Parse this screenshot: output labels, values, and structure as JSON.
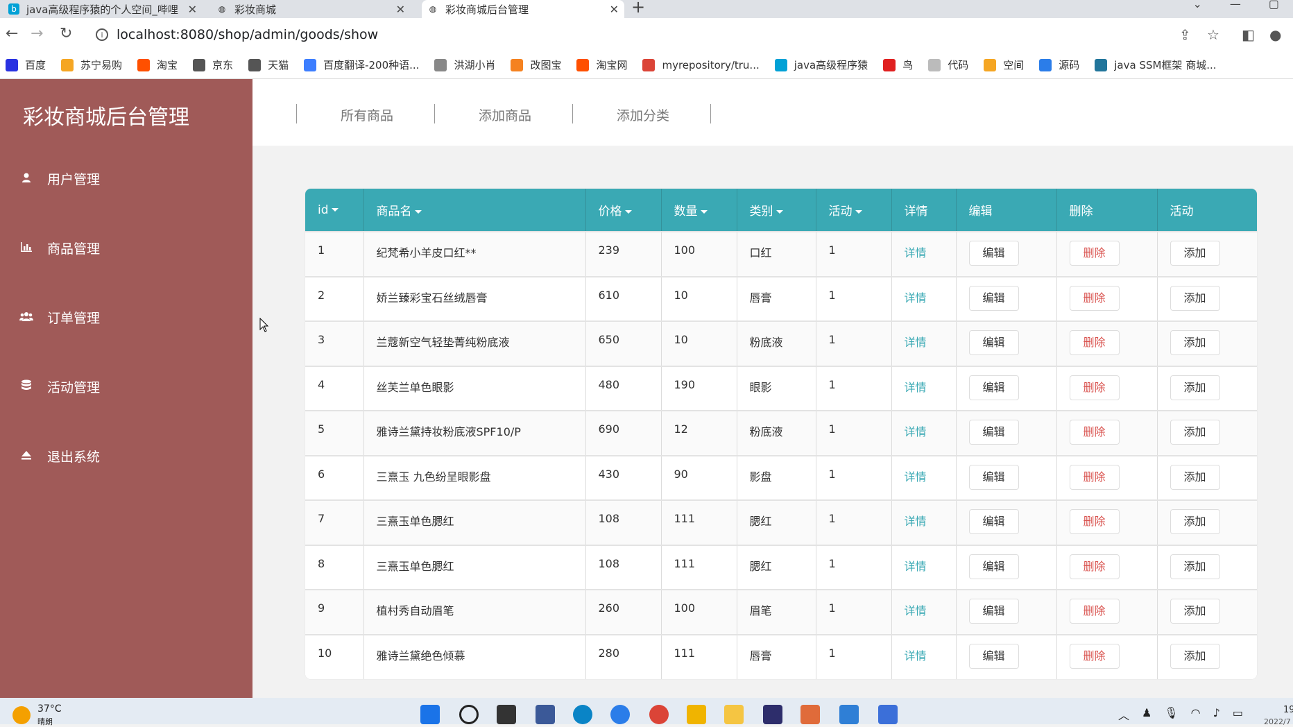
{
  "browser": {
    "tabs": [
      {
        "title": "java高级程序猿的个人空间_哔哩"
      },
      {
        "title": "彩妆商城"
      },
      {
        "title": "彩妆商城后台管理"
      }
    ],
    "url": "localhost:8080/shop/admin/goods/show",
    "bookmarks": [
      {
        "label": "百度",
        "icon": "baidu-icon"
      },
      {
        "label": "苏宁易购",
        "icon": "suning-icon"
      },
      {
        "label": "淘宝",
        "icon": "taobao-icon"
      },
      {
        "label": "京东",
        "icon": "globe-icon"
      },
      {
        "label": "天猫",
        "icon": "globe-icon"
      },
      {
        "label": "百度翻译-200种语...",
        "icon": "translate-icon"
      },
      {
        "label": "洪湖小肖",
        "icon": "bookmark-icon"
      },
      {
        "label": "改图宝",
        "icon": "image-icon"
      },
      {
        "label": "淘宝网",
        "icon": "taobao-icon"
      },
      {
        "label": "myrepository/tru...",
        "icon": "repo-icon"
      },
      {
        "label": "java高级程序猿",
        "icon": "bilibili-icon"
      },
      {
        "label": "鸟",
        "icon": "bird-icon"
      },
      {
        "label": "代码",
        "icon": "code-icon"
      },
      {
        "label": "空间",
        "icon": "qzone-icon"
      },
      {
        "label": "源码",
        "icon": "source-icon"
      },
      {
        "label": "java SSM框架 商城...",
        "icon": "wordpress-icon"
      }
    ]
  },
  "sidebar": {
    "brand": "彩妆商城后台管理",
    "items": [
      {
        "label": "用户管理",
        "icon": "user-icon"
      },
      {
        "label": "商品管理",
        "icon": "bar-chart-icon"
      },
      {
        "label": "订单管理",
        "icon": "users-icon"
      },
      {
        "label": "活动管理",
        "icon": "database-icon"
      },
      {
        "label": "退出系统",
        "icon": "eject-icon"
      }
    ]
  },
  "topnav": {
    "items": [
      "所有商品",
      "添加商品",
      "添加分类"
    ]
  },
  "table": {
    "headers": [
      {
        "label": "id",
        "sortable": true
      },
      {
        "label": "商品名",
        "sortable": true
      },
      {
        "label": "价格",
        "sortable": true
      },
      {
        "label": "数量",
        "sortable": true
      },
      {
        "label": "类别",
        "sortable": true
      },
      {
        "label": "活动",
        "sortable": true
      },
      {
        "label": "详情",
        "sortable": false
      },
      {
        "label": "编辑",
        "sortable": false
      },
      {
        "label": "删除",
        "sortable": false
      },
      {
        "label": "活动",
        "sortable": false
      }
    ],
    "detail_label": "详情",
    "edit_label": "编辑",
    "delete_label": "删除",
    "add_label": "添加",
    "rows": [
      {
        "id": "1",
        "name": "纪梵希小羊皮口红**",
        "price": "239",
        "qty": "100",
        "category": "口红",
        "activity": "1"
      },
      {
        "id": "2",
        "name": "娇兰臻彩宝石丝绒唇膏",
        "price": "610",
        "qty": "10",
        "category": "唇膏",
        "activity": "1"
      },
      {
        "id": "3",
        "name": "兰蔻新空气轻垫菁纯粉底液",
        "price": "650",
        "qty": "10",
        "category": "粉底液",
        "activity": "1"
      },
      {
        "id": "4",
        "name": "丝芙兰单色眼影",
        "price": "480",
        "qty": "190",
        "category": "眼影",
        "activity": "1"
      },
      {
        "id": "5",
        "name": "雅诗兰黛持妆粉底液SPF10/P",
        "price": "690",
        "qty": "12",
        "category": "粉底液",
        "activity": "1"
      },
      {
        "id": "6",
        "name": "三熹玉 九色纷呈眼影盘",
        "price": "430",
        "qty": "90",
        "category": "影盘",
        "activity": "1"
      },
      {
        "id": "7",
        "name": "三熹玉单色腮红",
        "price": "108",
        "qty": "111",
        "category": "腮红",
        "activity": "1"
      },
      {
        "id": "8",
        "name": "三熹玉单色腮红",
        "price": "108",
        "qty": "111",
        "category": "腮红",
        "activity": "1"
      },
      {
        "id": "9",
        "name": "植村秀自动眉笔",
        "price": "260",
        "qty": "100",
        "category": "眉笔",
        "activity": "1"
      },
      {
        "id": "10",
        "name": "雅诗兰黛绝色倾慕",
        "price": "280",
        "qty": "111",
        "category": "唇膏",
        "activity": "1"
      }
    ]
  },
  "taskbar": {
    "temperature": "37°C",
    "weather": "晴朗",
    "clock_time": "19",
    "clock_date": "2022/7"
  },
  "colors": {
    "sidebar_bg": "#a05a58",
    "header_bg": "#3aa9b4",
    "delete_text": "#d9534f"
  }
}
